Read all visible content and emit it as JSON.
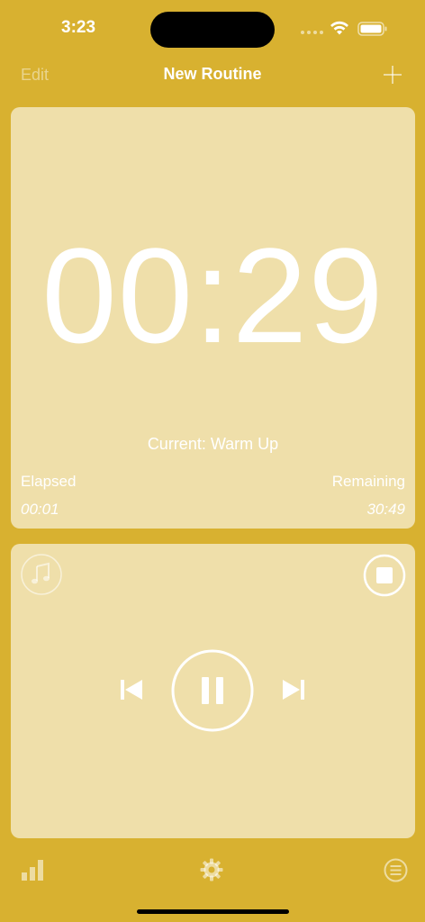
{
  "status_bar": {
    "time": "3:23",
    "icons": [
      "signal-icon",
      "wifi-icon",
      "battery-icon"
    ]
  },
  "nav": {
    "edit_label": "Edit",
    "title": "New Routine",
    "add_icon": "plus-icon"
  },
  "timer": {
    "display": "00:29",
    "current": "Current: Warm Up",
    "elapsed_label": "Elapsed",
    "elapsed_value": "00:01",
    "remaining_label": "Remaining",
    "remaining_value": "30:49"
  },
  "player": {
    "icons": [
      "music-note-icon",
      "stop-icon",
      "skip-back-icon",
      "pause-icon",
      "skip-forward-icon"
    ]
  },
  "tab_bar": {
    "icons": [
      "bar-chart-icon",
      "gear-icon",
      "list-icon"
    ]
  },
  "colors": {
    "background": "#D8B130",
    "card": "#EFDFAA",
    "text": "#FFFFFF"
  }
}
